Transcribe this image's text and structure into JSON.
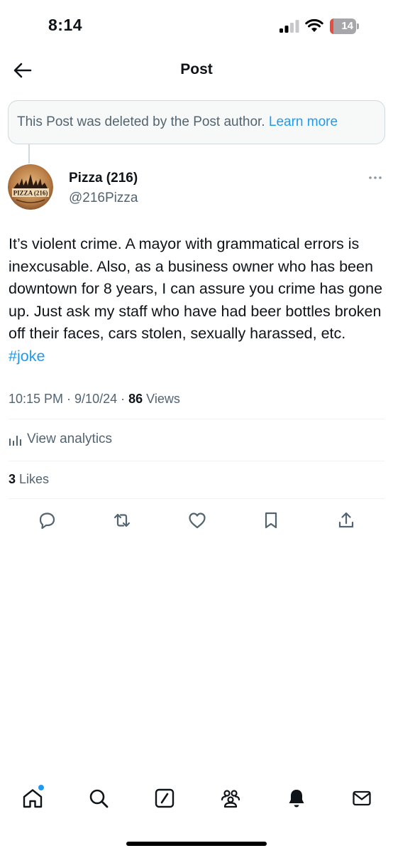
{
  "status_bar": {
    "time": "8:14",
    "battery_level": "14",
    "battery_fraction": 0.14,
    "battery_color": "#eb4d3d"
  },
  "header": {
    "back_icon": "arrow-left-icon",
    "title": "Post"
  },
  "deleted_notice": {
    "text": "This Post was deleted by the Post author. ",
    "link": "Learn more"
  },
  "post": {
    "author_name": "Pizza (216)",
    "author_handle": "@216Pizza",
    "avatar_text": "PIZZA (216)",
    "body": "It’s violent crime. A mayor with grammatical errors is inexcusable. Also, as a business owner who has been downtown for 8 years, I can assure you crime has gone up. Just ask my staff who have had beer bottles broken off their faces, cars stolen, sexually harassed, etc. ",
    "hashtag": "#joke",
    "time": "10:15 PM",
    "date": "9/10/24",
    "separator": " · ",
    "views_count": "86",
    "views_label": " Views",
    "analytics_label": "View analytics",
    "likes_count": "3",
    "likes_label": " Likes"
  },
  "actions": [
    "reply-icon",
    "repost-icon",
    "like-icon",
    "bookmark-icon",
    "share-icon"
  ],
  "tab_bar": [
    "home-icon",
    "search-icon",
    "grok-icon",
    "communities-icon",
    "notifications-icon",
    "messages-icon"
  ],
  "colors": {
    "accent": "#1d9bf0",
    "text_primary": "#0f1419",
    "text_secondary": "#536471",
    "border": "#cfd9de"
  }
}
